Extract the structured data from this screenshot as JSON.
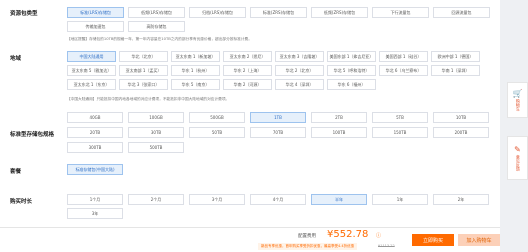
{
  "resource_type": {
    "label": "资源包类型",
    "row1": [
      "标准(LRS)存储包",
      "低频(LRS)存储包",
      "归档(LRS)存储包",
      "标准(ZRS)存储包",
      "低频(ZRS)存储包",
      "下行流量包",
      "回源流量包"
    ],
    "row2": [
      "传输加速包",
      "高防存储包"
    ],
    "selected": 0,
    "note": "【地区提醒】存储包的10TB的规格一年，第一年内容量在10TB之内的部分享有优惠价格，超出部分按标准计费。"
  },
  "region": {
    "label": "地域",
    "row1": [
      "中国大陆通用",
      "华北（北京）",
      "亚太东南 1（新加坡）",
      "亚太东南 2（悉尼）",
      "亚太东南 3（吉隆坡）",
      "美国东部 1（弗吉尼亚）",
      "美国西部 1（硅谷）",
      "欧洲中部 1（德国）"
    ],
    "row2": [
      "亚太东南 5（雅加达）",
      "亚太南部 1（孟买）",
      "华东 1（杭州）",
      "华东 2（上海）",
      "华北 2（北京）",
      "华北 5（呼和浩特）",
      "华北 6（乌兰察布）",
      "华南 1（深圳）"
    ],
    "row3": [
      "亚太东北 1（东京）",
      "华北 3（张家口）",
      "华东 5（南京）",
      "华南 2（河源）",
      "华北 4（深圳）",
      "华东 6（福州）"
    ],
    "selected": 0,
    "note": "【中国大陆通用】只能抵扣中国内地各地域的对应计费项，不能抵扣非中国大陆地域的对应计费项。"
  },
  "spec": {
    "label": "标准型存储包规格",
    "row1": [
      "40GB",
      "100GB",
      "500GB",
      "1TB",
      "2TB",
      "5TB",
      "10TB"
    ],
    "row2": [
      "20TB",
      "30TB",
      "50TB",
      "70TB",
      "100TB",
      "150TB",
      "200TB"
    ],
    "row3": [
      "300TB",
      "500TB"
    ],
    "selected": 3
  },
  "type": {
    "label": "套餐",
    "options": [
      "标准存储包(中国大陆)"
    ],
    "selected": 0
  },
  "duration": {
    "label": "购买时长",
    "row1": [
      "1个月",
      "2个月",
      "3个月",
      "4个月",
      "半年",
      "1年",
      "2年"
    ],
    "row2": [
      "3年"
    ],
    "selected": 4
  },
  "sidebar": {
    "cart": {
      "icon": "cart-icon",
      "text": "购物车"
    },
    "feedback": {
      "icon": "feedback-icon",
      "text": "意见反馈"
    }
  },
  "footer": {
    "price_label": "配置费用",
    "price": "¥552.78",
    "promo": "新品专享优惠，首年购买享受折扣优惠，最高享受4.4折优惠",
    "original_price": "¥1113.22",
    "buy_label": "立即购买",
    "cart_label": "加入购物车"
  },
  "colors": {
    "accent": "#ff6a00",
    "selected_bg": "#e6f0fb",
    "selected_border": "#9ec3ee"
  }
}
